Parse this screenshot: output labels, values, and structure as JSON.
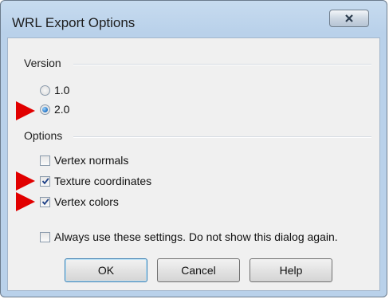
{
  "window": {
    "title": "WRL Export Options",
    "close_glyph": "X"
  },
  "version": {
    "label": "Version",
    "options": [
      {
        "label": "1.0",
        "selected": false
      },
      {
        "label": "2.0",
        "selected": true
      }
    ]
  },
  "options": {
    "label": "Options",
    "items": [
      {
        "label": "Vertex normals",
        "checked": false
      },
      {
        "label": "Texture coordinates",
        "checked": true
      },
      {
        "label": "Vertex colors",
        "checked": true
      }
    ]
  },
  "always": {
    "label": "Always use these settings. Do not show this dialog again.",
    "checked": false
  },
  "buttons": {
    "ok": "OK",
    "cancel": "Cancel",
    "help": "Help"
  },
  "colors": {
    "annotation_arrow": "#e10000",
    "title_bar": "#b9d1ea",
    "client_bg": "#f0f0f0"
  }
}
